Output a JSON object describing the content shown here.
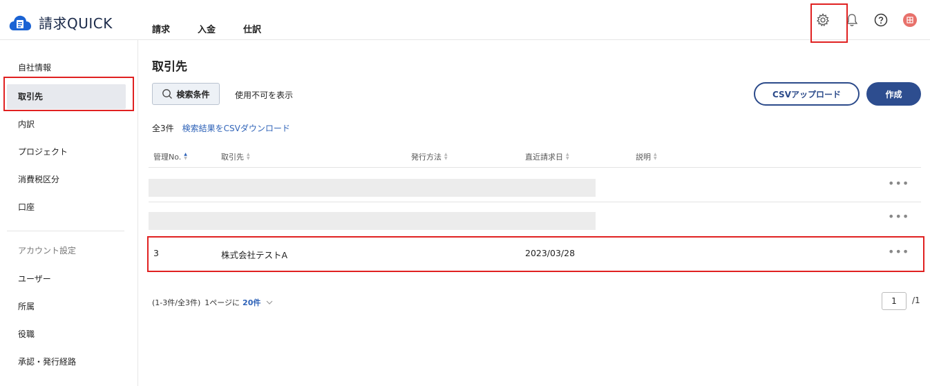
{
  "app": {
    "logo_text": "請求QUICK",
    "brand_color": "#1b63d3"
  },
  "topnav": {
    "items": [
      "請求",
      "入金",
      "仕訳"
    ]
  },
  "top_icons": [
    "gear-icon",
    "bell-icon",
    "help-icon",
    "avatar"
  ],
  "avatar": {
    "initial": "田",
    "color": "#e8716b"
  },
  "sidebar": {
    "items": [
      "自社情報",
      "取引先",
      "内訳",
      "プロジェクト",
      "消費税区分",
      "口座"
    ],
    "active": "取引先",
    "account_heading": "アカウント設定",
    "account_items": [
      "ユーザー",
      "所属",
      "役職",
      "承認・発行経路"
    ]
  },
  "main": {
    "title": "取引先",
    "search_button": "検索条件",
    "show_disabled": "使用不可を表示",
    "csv_upload": "CSVアップロード",
    "create": "作成",
    "count": "全3件",
    "csv_download": "検索結果をCSVダウンロード",
    "columns": [
      "管理No.",
      "取引先",
      "発行方法",
      "直近請求日",
      "説明"
    ],
    "rows": [
      {
        "no": "",
        "partner": "",
        "method": "",
        "date": "",
        "desc": "",
        "loading": true
      },
      {
        "no": "",
        "partner": "",
        "method": "",
        "date": "",
        "desc": "",
        "loading": true
      },
      {
        "no": "3",
        "partner": "株式会社テストA",
        "method": "",
        "date": "2023/03/28",
        "desc": "",
        "loading": false
      }
    ],
    "more_label": "•••"
  },
  "pagination": {
    "summary": "(1-3件/全3件)",
    "per_page_label": "1ページに",
    "per_page": "20件",
    "page": "1",
    "total": "/1"
  }
}
